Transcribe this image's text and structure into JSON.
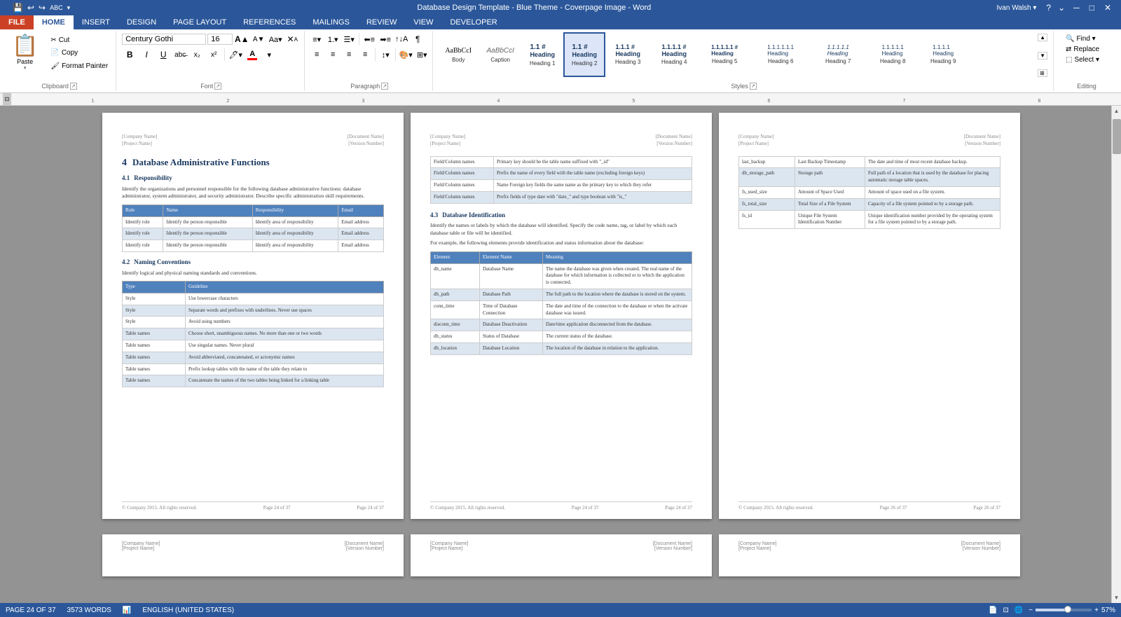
{
  "titlebar": {
    "title": "Database Design Template - Blue Theme - Coverpage Image - Word",
    "minimize": "─",
    "restore": "□",
    "close": "✕"
  },
  "qat": {
    "save": "💾",
    "undo": "↩",
    "redo": "↪",
    "spellcheck": "ABC",
    "customQat": "▾"
  },
  "tabs": [
    "FILE",
    "HOME",
    "INSERT",
    "DESIGN",
    "PAGE LAYOUT",
    "REFERENCES",
    "MAILINGS",
    "REVIEW",
    "VIEW",
    "DEVELOPER"
  ],
  "activeTab": "HOME",
  "ribbon": {
    "clipboard": {
      "paste": "Paste",
      "cut": "✂ Cut",
      "copy": "📋 Copy",
      "formatPainter": "🖌 Format Painter"
    },
    "font": {
      "fontName": "Century Gothi",
      "fontSize": "16",
      "growFont": "A▲",
      "shrinkFont": "A▼",
      "clearFormatting": "✕",
      "bold": "B",
      "italic": "I",
      "underline": "U",
      "strikethrough": "abc",
      "subscript": "x₂",
      "superscript": "x²",
      "changeCase": "Aa▾",
      "textColor": "A",
      "textHighlight": "🖊"
    },
    "paragraph": {
      "label": "Paragraph"
    },
    "styles": {
      "label": "Styles",
      "items": [
        {
          "label": "Body",
          "preview": "AaBbCcI",
          "class": "normal"
        },
        {
          "label": "Caption",
          "preview": "AaBbCcI",
          "class": "caption"
        },
        {
          "label": "Heading 1",
          "preview": "1.1 #",
          "class": "h1"
        },
        {
          "label": "Heading 2",
          "preview": "1.1 #",
          "class": "h2",
          "active": true
        },
        {
          "label": "Heading 3",
          "preview": "1.1.1",
          "class": "h3"
        },
        {
          "label": "Heading 4",
          "preview": "1.1.1.1",
          "class": "h4"
        },
        {
          "label": "Heading 5",
          "preview": "1.1.1.1.1",
          "class": "h5"
        },
        {
          "label": "Heading 6",
          "preview": "1.1.1.1.1.1",
          "class": "h6"
        },
        {
          "label": "Heading 7",
          "preview": "1.1.1.1.1",
          "class": "h7"
        },
        {
          "label": "Heading 8",
          "preview": "1.1.1.1",
          "class": "h8"
        },
        {
          "label": "Heading 9",
          "preview": "1.1.1",
          "class": "h9"
        }
      ]
    },
    "editing": {
      "label": "Editing",
      "find": "🔍 Find ▾",
      "replace": "Replace",
      "select": "Select ▾"
    }
  },
  "pages": [
    {
      "id": "page1",
      "header": {
        "company": "[Company Name]",
        "document": "[Document Name]",
        "project": "[Project Name]",
        "version": "[Version Number]"
      },
      "content": {
        "sectionNum": "4",
        "sectionTitle": "Database Administrative Functions",
        "sub1Num": "4.1",
        "sub1Title": "Responsibility",
        "sub1Text": "Identify the organizations and personnel responsible for the following database administrative functions: database administrator, system administrator, and security administrator. Describe specific administration skill requirements.",
        "table1": {
          "headers": [
            "Role",
            "Name",
            "Responsibility",
            "Email"
          ],
          "rows": [
            [
              "Identify role",
              "Identify the person responsible",
              "Identify area of responsibility",
              "Email address"
            ],
            [
              "Identify role",
              "Identify the person responsible",
              "Identify area of responsibility",
              "Email address"
            ],
            [
              "Identify role",
              "Identify the person responsible",
              "Identify area of responsibility",
              "Email address"
            ]
          ]
        },
        "sub2Num": "4.2",
        "sub2Title": "Naming Conventions",
        "sub2Text": "Identify logical and physical naming standards and conventions.",
        "table2": {
          "headers": [
            "Type",
            "Guideline"
          ],
          "rows": [
            [
              "Style",
              "Use lowercase characters"
            ],
            [
              "Style",
              "Separate words and prefixes with underlines. Never use spaces"
            ],
            [
              "Style",
              "Avoid using numbers"
            ],
            [
              "Table names",
              "Choose short, unambiguous names. No more than one or two words"
            ],
            [
              "Table names",
              "Use singular names. Never plural"
            ],
            [
              "Table names",
              "Avoid abbreviated, concatenated, or acronymic names"
            ],
            [
              "Table names",
              "Prefix lookup tables with the name of the table they relate to"
            ],
            [
              "Table names",
              "Concatenate the names of the two tables being linked for a linking table"
            ]
          ]
        }
      },
      "footer": {
        "left": "© Company 2015. All rights reserved.",
        "center": "Page 24 of 37",
        "right": "Page 24 of 37"
      }
    },
    {
      "id": "page2",
      "header": {
        "company": "[Company Name]",
        "document": "[Document Name]",
        "project": "[Project Name]",
        "version": "[Version Number]"
      },
      "content": {
        "fieldTable": {
          "rows": [
            [
              "Field/Column names",
              "Primary key should be the table name suffixed with \"_id\""
            ],
            [
              "Field/Column names",
              "Prefix the name of every field with the table name (excluding foreign keys)"
            ],
            [
              "Field/Column names",
              "Name Foreign key fields the same name as the primary key to which they refer"
            ],
            [
              "Field/Column names",
              "Prefix fields of type date with \"date_\" and type boolean with \"is_\""
            ]
          ]
        },
        "sub3Num": "4.3",
        "sub3Title": "Database Identification",
        "sub3Text": "Identify the names or labels by which the database will identified. Specify the code name, tag, or label by which each database table or file will be identified.",
        "sub3Text2": "For example, the following elements provide identification and status information about the database:",
        "identifyTable": {
          "headers": [
            "Element",
            "Element Name",
            "Meaning"
          ],
          "rows": [
            [
              "db_name",
              "Database Name",
              "The name the database was given when created. The real name of the database for which information is collected or to which the application is connected."
            ],
            [
              "db_path",
              "Database Path",
              "The full path to the location where the database is stored on the system."
            ],
            [
              "conn_time",
              "Time of Database Connection",
              "The date and time of the connection to the database or when the activate database was issued."
            ],
            [
              "disconn_time",
              "Database Deactivation",
              "Date/time application disconnected from the database."
            ],
            [
              "db_status",
              "Status of Database",
              "The current status of the database."
            ],
            [
              "db_location",
              "Database Location",
              "The location of the database in relation to the application."
            ]
          ]
        }
      },
      "footer": {
        "left": "© Company 2015. All rights reserved.",
        "center": "Page 24 of 37",
        "right": "Page 24 of 37"
      }
    },
    {
      "id": "page3",
      "header": {
        "company": "[Company Name]",
        "document": "[Document Name]",
        "project": "[Project Name]",
        "version": "[Version Number]"
      },
      "content": {
        "storageTable": {
          "rows": [
            [
              "last_backup",
              "Last Backup Timestamp",
              "The date and time of most recent database backup."
            ],
            [
              "db_storage_path",
              "Storage path",
              "Full path of a location that is used by the database for placing automatic storage table spaces."
            ],
            [
              "fs_used_size",
              "Amount of Space Used",
              "Amount of space used on a file system."
            ],
            [
              "fs_total_size",
              "Total Size of a File System",
              "Capacity of a file system pointed to by a storage path."
            ],
            [
              "fs_id",
              "Unique File System Identification Number",
              "Unique identification number provided by the operating system for a file system pointed to by a storage path."
            ]
          ]
        }
      },
      "footer": {
        "left": "© Company 2015. All rights reserved.",
        "center": "Page 26 of 37",
        "right": "Page 26 of 37"
      }
    }
  ],
  "statusBar": {
    "pageInfo": "PAGE 24 OF 37",
    "wordCount": "3573 WORDS",
    "language": "ENGLISH (UNITED STATES)",
    "zoom": "57%"
  },
  "user": "Ivan Walsh"
}
